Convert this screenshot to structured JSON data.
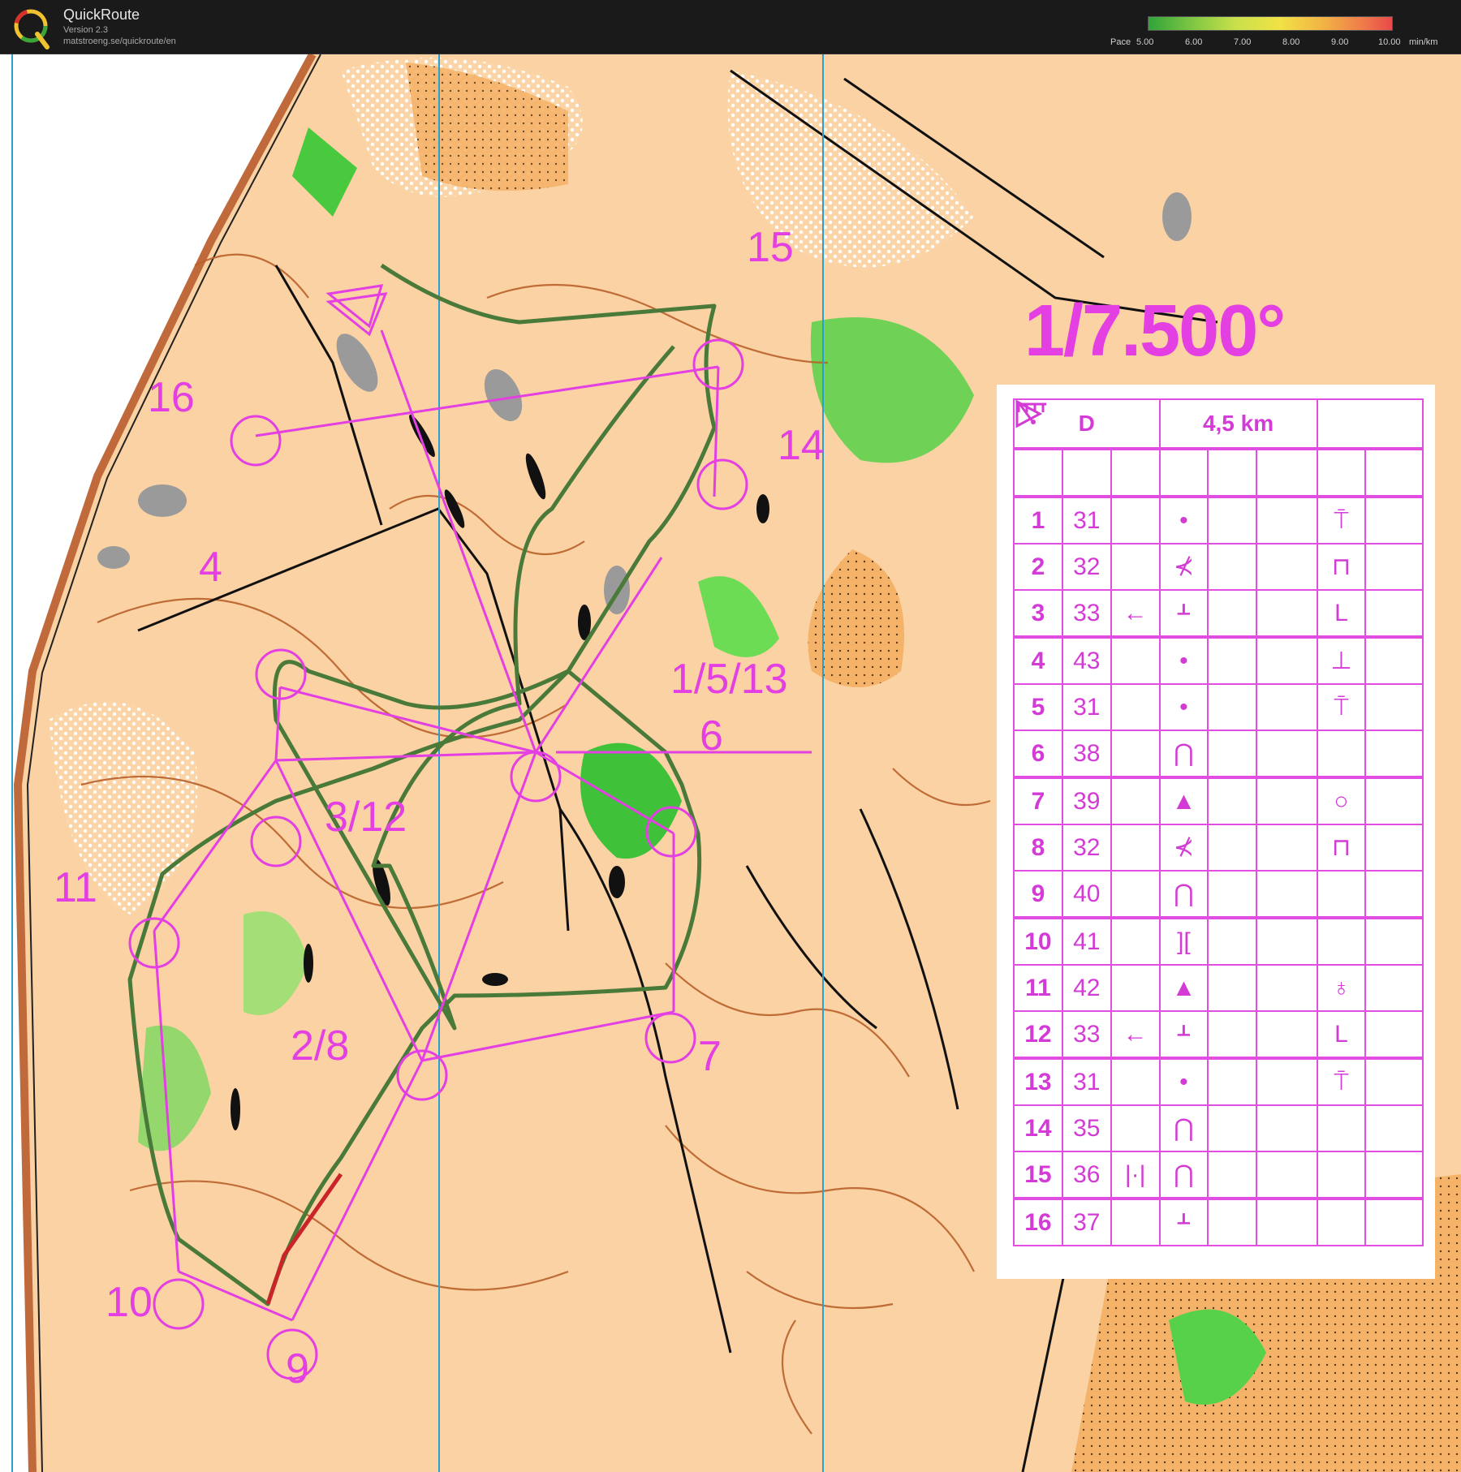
{
  "app": {
    "title": "QuickRoute",
    "version": "Version 2.3",
    "url": "matstroeng.se/quickroute/en"
  },
  "pace_legend": {
    "label": "Pace",
    "ticks": [
      "5.00",
      "6.00",
      "7.00",
      "8.00",
      "9.00",
      "10.00"
    ],
    "unit": "min/km",
    "colors": [
      "#31a33a",
      "#7ec743",
      "#c9e04b",
      "#f1e245",
      "#f2b245",
      "#ef7b4b",
      "#e84a4a"
    ]
  },
  "map": {
    "scale": "1/7.500°",
    "course_color": "#e33fe3",
    "route_color": "#4a7a3a",
    "control_labels": [
      "15",
      "16",
      "14",
      "4",
      "1/5/13",
      "6",
      "3/12",
      "11",
      "2/8",
      "7",
      "10",
      "9"
    ]
  },
  "description_sheet": {
    "header": {
      "class": "D",
      "length": "4,5 km"
    },
    "start_row": {
      "start_icon": "start-triangle-icon",
      "feature_icon": "path-end-icon",
      "detail_icon": "flag-icon"
    },
    "rows": [
      {
        "num": "1",
        "code": "31",
        "dir": "",
        "feature": "•",
        "detail": "⍑"
      },
      {
        "num": "2",
        "code": "32",
        "dir": "",
        "feature": "⊀",
        "detail": "⊓"
      },
      {
        "num": "3",
        "code": "33",
        "dir": "←",
        "feature": "ᚆ",
        "detail": "L"
      },
      {
        "num": "4",
        "code": "43",
        "dir": "",
        "feature": "•",
        "detail": "⊥"
      },
      {
        "num": "5",
        "code": "31",
        "dir": "",
        "feature": "•",
        "detail": "⍑"
      },
      {
        "num": "6",
        "code": "38",
        "dir": "",
        "feature": "⋂",
        "detail": ""
      },
      {
        "num": "7",
        "code": "39",
        "dir": "",
        "feature": "▲",
        "detail": "○"
      },
      {
        "num": "8",
        "code": "32",
        "dir": "",
        "feature": "⊀",
        "detail": "⊓"
      },
      {
        "num": "9",
        "code": "40",
        "dir": "",
        "feature": "⋂",
        "detail": ""
      },
      {
        "num": "10",
        "code": "41",
        "dir": "",
        "feature": "][",
        "detail": ""
      },
      {
        "num": "11",
        "code": "42",
        "dir": "",
        "feature": "▲",
        "detail": "♁"
      },
      {
        "num": "12",
        "code": "33",
        "dir": "←",
        "feature": "ᚆ",
        "detail": "L"
      },
      {
        "num": "13",
        "code": "31",
        "dir": "",
        "feature": "•",
        "detail": "⍑"
      },
      {
        "num": "14",
        "code": "35",
        "dir": "",
        "feature": "⋂",
        "detail": ""
      },
      {
        "num": "15",
        "code": "36",
        "dir": "|·|",
        "feature": "⋂",
        "detail": ""
      },
      {
        "num": "16",
        "code": "37",
        "dir": "",
        "feature": "ᚆ",
        "detail": ""
      }
    ]
  }
}
